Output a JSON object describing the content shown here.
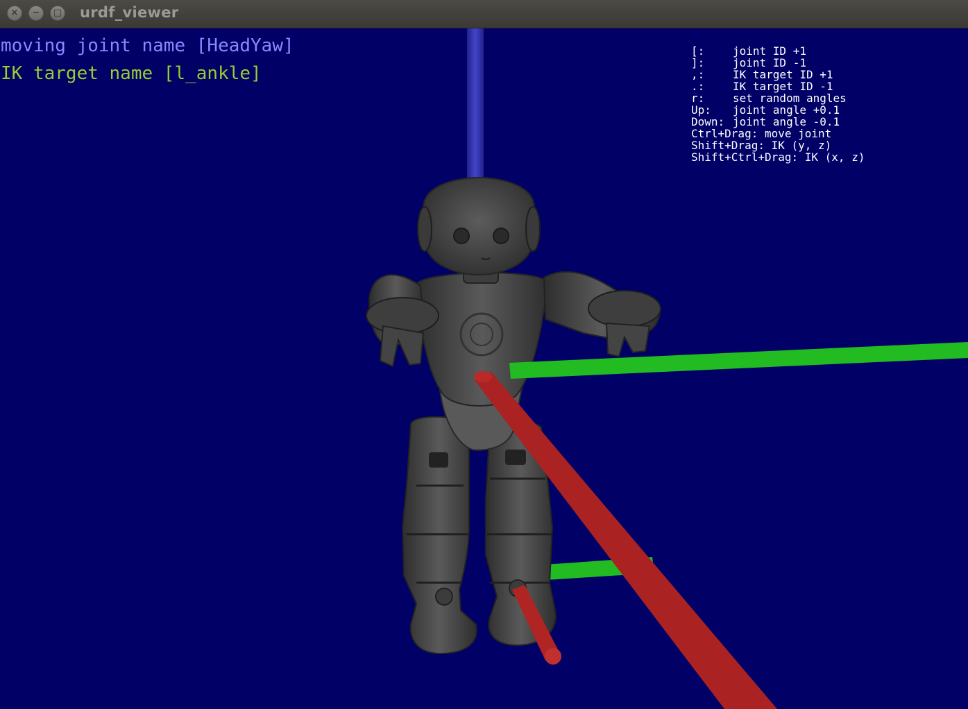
{
  "window": {
    "title": "urdf_viewer",
    "close_icon": "×",
    "minimize_icon": "−",
    "maximize_icon": "□"
  },
  "overlay": {
    "moving_joint": "moving joint name [HeadYaw]",
    "ik_target": "IK target name [l_ankle]",
    "moving_joint_color": "#8888ff",
    "ik_target_color": "#9acd32"
  },
  "help": [
    {
      "key": "[:",
      "action": "joint ID +1"
    },
    {
      "key": "]:",
      "action": "joint ID -1"
    },
    {
      "key": ",:",
      "action": "IK target ID +1"
    },
    {
      "key": ".:",
      "action": "IK target ID -1"
    },
    {
      "key": "r:",
      "action": "set random angles"
    },
    {
      "key": "Up:",
      "action": "joint angle +0.1"
    },
    {
      "key": "Down:",
      "action": "joint angle -0.1"
    },
    {
      "key": "Ctrl+Drag:",
      "action": "move joint"
    },
    {
      "key": "Shift+Drag:",
      "action": "IK (y, z)"
    },
    {
      "key": "Shift+Ctrl+Drag:",
      "action": "IK (x, z)"
    }
  ],
  "scene": {
    "background_color": "#000066",
    "robot_color": "#4a4a4a",
    "axis_x_color": "#b22222",
    "axis_y_color": "#22aa22",
    "axis_z_color": "#3333bb",
    "robot_icon": "nao-robot-model"
  }
}
